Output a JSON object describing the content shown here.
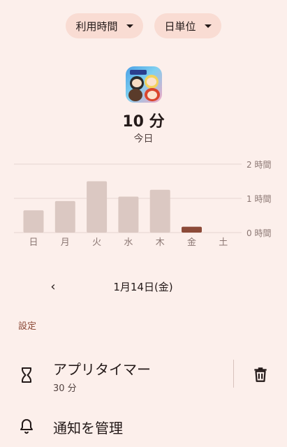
{
  "filters": {
    "metric": {
      "label": "利用時間"
    },
    "granularity": {
      "label": "日単位"
    }
  },
  "app": {
    "icon": "tsum-tsum-app-icon"
  },
  "summary": {
    "usage_time": "10 分",
    "period": "今日"
  },
  "chart_data": {
    "type": "bar",
    "categories": [
      "日",
      "月",
      "火",
      "水",
      "木",
      "金",
      "土"
    ],
    "values": [
      0.65,
      0.92,
      1.5,
      1.05,
      1.25,
      0.17,
      0
    ],
    "unit": "hours",
    "ylim": [
      0,
      2
    ],
    "ytick_values": [
      0,
      1,
      2
    ],
    "ytick_labels": [
      "0 時間",
      "1 時間",
      "2 時間"
    ],
    "highlight_index": 5,
    "colors": {
      "bar": "#dbc8c2",
      "highlight": "#8c4a38",
      "grid": "#e6d6d1"
    },
    "grid": true
  },
  "date_nav": {
    "prev_icon": "chevron-left-icon",
    "prev_glyph": "‹",
    "date": "1月14日(金)"
  },
  "settings": {
    "header": "設定",
    "app_timer": {
      "icon": "hourglass-icon",
      "title": "アプリタイマー",
      "value": "30 分",
      "delete_icon": "trash-icon"
    },
    "notifications": {
      "icon": "bell-icon",
      "title": "通知を管理"
    }
  }
}
